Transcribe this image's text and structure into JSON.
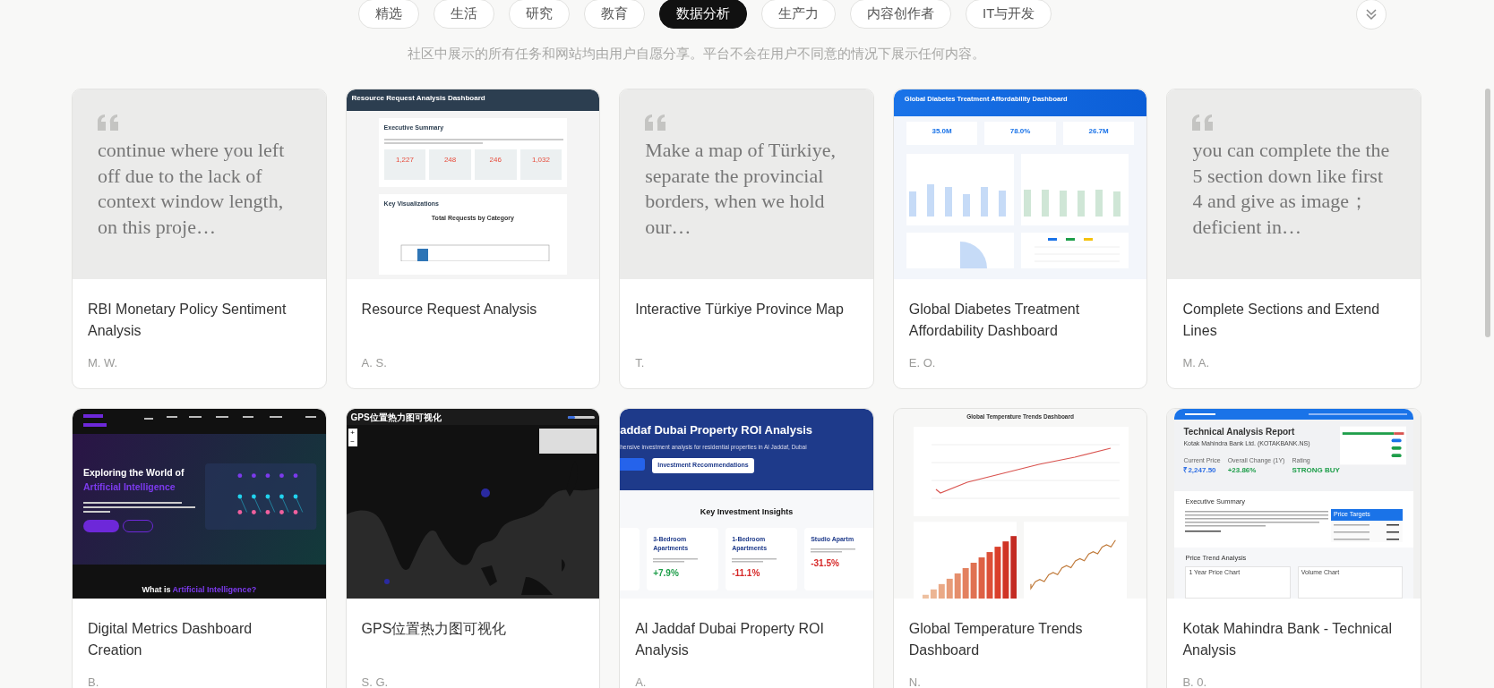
{
  "tabs": [
    {
      "label": "精选",
      "selected": false
    },
    {
      "label": "生活",
      "selected": false
    },
    {
      "label": "研究",
      "selected": false
    },
    {
      "label": "教育",
      "selected": false
    },
    {
      "label": "数据分析",
      "selected": true
    },
    {
      "label": "生产力",
      "selected": false
    },
    {
      "label": "内容创作者",
      "selected": false
    },
    {
      "label": "IT与开发",
      "selected": false
    }
  ],
  "notice": "社区中展示的所有任务和网站均由用户自愿分享。平台不会在用户不同意的情况下展示任何内容。",
  "cards": [
    {
      "title": "RBI Monetary Policy Sentiment Analysis",
      "author": "M. W.",
      "preview": {
        "kind": "quote",
        "text": "continue where you left off due to the lack of context window length, on this proje…"
      }
    },
    {
      "title": "Resource Request Analysis",
      "author": "A. S.",
      "preview": {
        "kind": "resource",
        "title": "Resource Request Analysis Dashboard",
        "section": "Executive Summary",
        "stats": [
          "1,227",
          "248",
          "246",
          "1,032"
        ],
        "section_2": "Key Visualizations",
        "chart_title": "Total Requests by Category"
      }
    },
    {
      "title": "Interactive Türkiye Province Map",
      "author": "T.",
      "preview": {
        "kind": "quote",
        "text": "Make a map of Türkiye, separate the provincial borders, when we hold our…"
      }
    },
    {
      "title": "Global Diabetes Treatment Affordability Dashboard",
      "author": "E. O.",
      "preview": {
        "kind": "diabetes",
        "title": "Global Diabetes Treatment Affordability Dashboard",
        "stats": [
          "35.0M",
          "78.0%",
          "26.7M"
        ]
      }
    },
    {
      "title": "Complete Sections and Extend Lines",
      "author": "M. A.",
      "preview": {
        "kind": "quote",
        "text": "you can complete the the 5 section down like first 4 and give as image；deficient in…"
      }
    },
    {
      "title": "Digital Metrics Dashboard Creation",
      "author": "B.",
      "preview": {
        "kind": "ai",
        "heading": "Exploring the World of",
        "accent": "Artificial Intelligence",
        "heading_2": "What is",
        "accent_2": "Artificial Intelligence?"
      }
    },
    {
      "title": "GPS位置热力图可视化",
      "author": "S. G.",
      "preview": {
        "kind": "gps",
        "title": "GPS位置热力图可视化",
        "level": 0.25,
        "zoom_in": "+",
        "zoom_out": "−"
      }
    },
    {
      "title": "Al Jaddaf Dubai Property ROI Analysis",
      "author": "A.",
      "preview": {
        "kind": "dubai",
        "title": "addaf Dubai Property ROI Analysis",
        "subtitle": "hensive investment analysis for residential properties in Al Jaddaf, Dubai",
        "button": "Investment Recommendations",
        "section": "Key Investment Insights",
        "items": [
          {
            "name": "3-Bedroom Apartments",
            "change": "+7.9%",
            "color": "#1e9e4a"
          },
          {
            "name": "1-Bedroom Apartments",
            "change": "-11.1%",
            "color": "#d62828"
          },
          {
            "name": "Studio Apartm",
            "change": "-31.5%",
            "color": "#d62828"
          }
        ]
      }
    },
    {
      "title": "Global Temperature Trends Dashboard",
      "author": "N.",
      "preview": {
        "kind": "temperature",
        "title": "Global Temperature Trends Dashboard"
      }
    },
    {
      "title": "Kotak Mahindra Bank - Technical Analysis",
      "author": "B. 0.",
      "preview": {
        "kind": "kotak",
        "title": "Technical Analysis Report",
        "company": "Kotak Mahindra Bank Ltd. (KOTAKBANK.NS)",
        "metrics": [
          {
            "label": "Current Price",
            "value": "₹2,247.50",
            "color": "#2f6fe4"
          },
          {
            "label": "Overall Change (1Y)",
            "value": "+23.86%",
            "color": "#1e9e4a"
          },
          {
            "label": "Rating",
            "value": "STRONG BUY",
            "color": "#1e9e4a"
          }
        ],
        "section": "Executive Summary",
        "targets": "Price Targets",
        "section_2": "Price Trend Analysis",
        "charts": [
          "1 Year Price Chart",
          "Volume Chart"
        ]
      }
    }
  ]
}
